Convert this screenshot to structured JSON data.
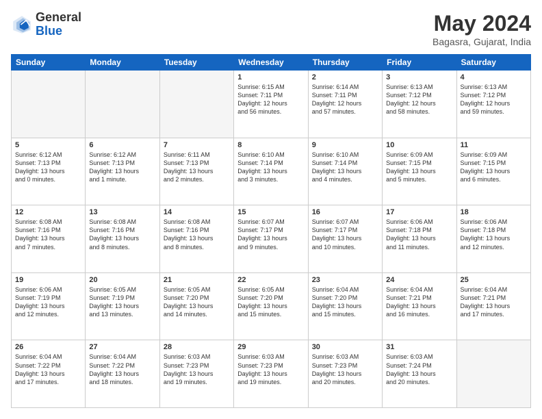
{
  "header": {
    "logo_general": "General",
    "logo_blue": "Blue",
    "month_title": "May 2024",
    "location": "Bagasra, Gujarat, India"
  },
  "weekdays": [
    "Sunday",
    "Monday",
    "Tuesday",
    "Wednesday",
    "Thursday",
    "Friday",
    "Saturday"
  ],
  "weeks": [
    [
      {
        "day": "",
        "info": ""
      },
      {
        "day": "",
        "info": ""
      },
      {
        "day": "",
        "info": ""
      },
      {
        "day": "1",
        "info": "Sunrise: 6:15 AM\nSunset: 7:11 PM\nDaylight: 12 hours\nand 56 minutes."
      },
      {
        "day": "2",
        "info": "Sunrise: 6:14 AM\nSunset: 7:11 PM\nDaylight: 12 hours\nand 57 minutes."
      },
      {
        "day": "3",
        "info": "Sunrise: 6:13 AM\nSunset: 7:12 PM\nDaylight: 12 hours\nand 58 minutes."
      },
      {
        "day": "4",
        "info": "Sunrise: 6:13 AM\nSunset: 7:12 PM\nDaylight: 12 hours\nand 59 minutes."
      }
    ],
    [
      {
        "day": "5",
        "info": "Sunrise: 6:12 AM\nSunset: 7:13 PM\nDaylight: 13 hours\nand 0 minutes."
      },
      {
        "day": "6",
        "info": "Sunrise: 6:12 AM\nSunset: 7:13 PM\nDaylight: 13 hours\nand 1 minute."
      },
      {
        "day": "7",
        "info": "Sunrise: 6:11 AM\nSunset: 7:13 PM\nDaylight: 13 hours\nand 2 minutes."
      },
      {
        "day": "8",
        "info": "Sunrise: 6:10 AM\nSunset: 7:14 PM\nDaylight: 13 hours\nand 3 minutes."
      },
      {
        "day": "9",
        "info": "Sunrise: 6:10 AM\nSunset: 7:14 PM\nDaylight: 13 hours\nand 4 minutes."
      },
      {
        "day": "10",
        "info": "Sunrise: 6:09 AM\nSunset: 7:15 PM\nDaylight: 13 hours\nand 5 minutes."
      },
      {
        "day": "11",
        "info": "Sunrise: 6:09 AM\nSunset: 7:15 PM\nDaylight: 13 hours\nand 6 minutes."
      }
    ],
    [
      {
        "day": "12",
        "info": "Sunrise: 6:08 AM\nSunset: 7:16 PM\nDaylight: 13 hours\nand 7 minutes."
      },
      {
        "day": "13",
        "info": "Sunrise: 6:08 AM\nSunset: 7:16 PM\nDaylight: 13 hours\nand 8 minutes."
      },
      {
        "day": "14",
        "info": "Sunrise: 6:08 AM\nSunset: 7:16 PM\nDaylight: 13 hours\nand 8 minutes."
      },
      {
        "day": "15",
        "info": "Sunrise: 6:07 AM\nSunset: 7:17 PM\nDaylight: 13 hours\nand 9 minutes."
      },
      {
        "day": "16",
        "info": "Sunrise: 6:07 AM\nSunset: 7:17 PM\nDaylight: 13 hours\nand 10 minutes."
      },
      {
        "day": "17",
        "info": "Sunrise: 6:06 AM\nSunset: 7:18 PM\nDaylight: 13 hours\nand 11 minutes."
      },
      {
        "day": "18",
        "info": "Sunrise: 6:06 AM\nSunset: 7:18 PM\nDaylight: 13 hours\nand 12 minutes."
      }
    ],
    [
      {
        "day": "19",
        "info": "Sunrise: 6:06 AM\nSunset: 7:19 PM\nDaylight: 13 hours\nand 12 minutes."
      },
      {
        "day": "20",
        "info": "Sunrise: 6:05 AM\nSunset: 7:19 PM\nDaylight: 13 hours\nand 13 minutes."
      },
      {
        "day": "21",
        "info": "Sunrise: 6:05 AM\nSunset: 7:20 PM\nDaylight: 13 hours\nand 14 minutes."
      },
      {
        "day": "22",
        "info": "Sunrise: 6:05 AM\nSunset: 7:20 PM\nDaylight: 13 hours\nand 15 minutes."
      },
      {
        "day": "23",
        "info": "Sunrise: 6:04 AM\nSunset: 7:20 PM\nDaylight: 13 hours\nand 15 minutes."
      },
      {
        "day": "24",
        "info": "Sunrise: 6:04 AM\nSunset: 7:21 PM\nDaylight: 13 hours\nand 16 minutes."
      },
      {
        "day": "25",
        "info": "Sunrise: 6:04 AM\nSunset: 7:21 PM\nDaylight: 13 hours\nand 17 minutes."
      }
    ],
    [
      {
        "day": "26",
        "info": "Sunrise: 6:04 AM\nSunset: 7:22 PM\nDaylight: 13 hours\nand 17 minutes."
      },
      {
        "day": "27",
        "info": "Sunrise: 6:04 AM\nSunset: 7:22 PM\nDaylight: 13 hours\nand 18 minutes."
      },
      {
        "day": "28",
        "info": "Sunrise: 6:03 AM\nSunset: 7:23 PM\nDaylight: 13 hours\nand 19 minutes."
      },
      {
        "day": "29",
        "info": "Sunrise: 6:03 AM\nSunset: 7:23 PM\nDaylight: 13 hours\nand 19 minutes."
      },
      {
        "day": "30",
        "info": "Sunrise: 6:03 AM\nSunset: 7:23 PM\nDaylight: 13 hours\nand 20 minutes."
      },
      {
        "day": "31",
        "info": "Sunrise: 6:03 AM\nSunset: 7:24 PM\nDaylight: 13 hours\nand 20 minutes."
      },
      {
        "day": "",
        "info": ""
      }
    ]
  ]
}
